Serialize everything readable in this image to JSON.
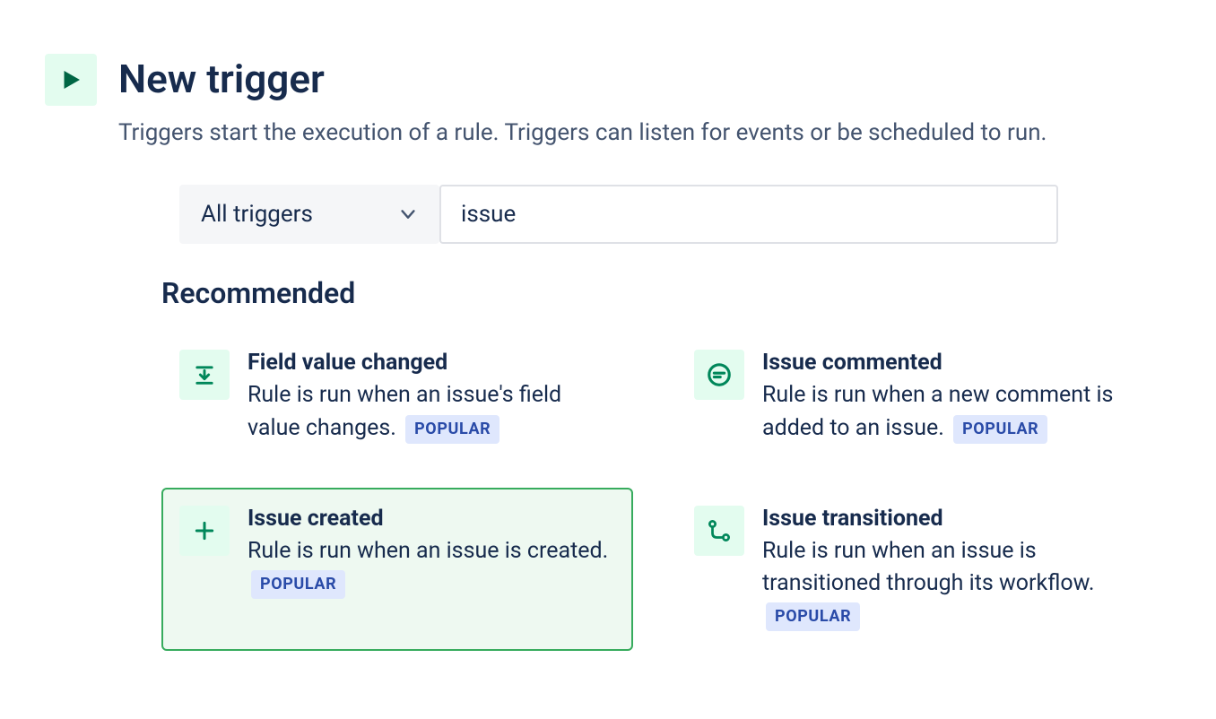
{
  "header": {
    "title": "New trigger",
    "description": "Triggers start the execution of a rule. Triggers can listen for events or be scheduled to run."
  },
  "filter": {
    "dropdown_label": "All triggers",
    "search_value": "issue"
  },
  "section_heading": "Recommended",
  "badge_label": "POPULAR",
  "cards": [
    {
      "title": "Field value changed",
      "description": "Rule is run when an issue's field value changes.",
      "selected": false,
      "icon": "download-line"
    },
    {
      "title": "Issue commented",
      "description": "Rule is run when a new comment is added to an issue.",
      "selected": false,
      "icon": "comment"
    },
    {
      "title": "Issue created",
      "description": "Rule is run when an issue is created.",
      "selected": true,
      "icon": "plus"
    },
    {
      "title": "Issue transitioned",
      "description": "Rule is run when an issue is transitioned through its workflow.",
      "selected": false,
      "icon": "workflow"
    }
  ],
  "colors": {
    "accent_green": "#00875A",
    "accent_bg": "#E3FCEF",
    "badge_bg": "#DFE7FD",
    "badge_text": "#2A4BA8",
    "text_primary": "#172B4D",
    "text_secondary": "#44546F",
    "selected_border": "#37AB5D",
    "selected_bg": "#EEF9F1"
  }
}
